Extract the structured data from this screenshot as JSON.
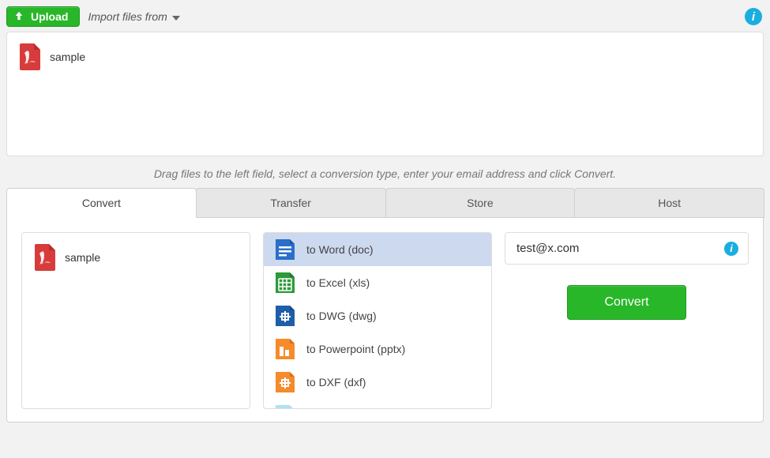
{
  "toolbar": {
    "upload_label": "Upload",
    "import_label": "Import files from"
  },
  "dropzone": {
    "file_name": "sample"
  },
  "hint": "Drag files to the left field, select a conversion type, enter your email address and click Convert.",
  "tabs": [
    {
      "label": "Convert",
      "active": true
    },
    {
      "label": "Transfer",
      "active": false
    },
    {
      "label": "Store",
      "active": false
    },
    {
      "label": "Host",
      "active": false
    }
  ],
  "panel": {
    "selected_file": "sample",
    "formats": [
      {
        "label": "to Word (doc)",
        "icon": "word",
        "color": "#2a6fc9",
        "selected": true
      },
      {
        "label": "to Excel (xls)",
        "icon": "excel",
        "color": "#2e9a3a",
        "selected": false
      },
      {
        "label": "to DWG (dwg)",
        "icon": "dwg",
        "color": "#1f5ea8",
        "selected": false
      },
      {
        "label": "to Powerpoint (pptx)",
        "icon": "ppt",
        "color": "#f58b2a",
        "selected": false
      },
      {
        "label": "to DXF (dxf)",
        "icon": "dxf",
        "color": "#f58b2a",
        "selected": false
      }
    ],
    "email": "test@x.com",
    "convert_label": "Convert"
  }
}
